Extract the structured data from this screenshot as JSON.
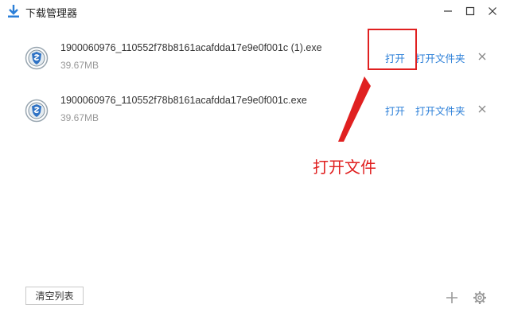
{
  "window": {
    "title": "下载管理器"
  },
  "downloads": [
    {
      "file_name": "1900060976_110552f78b8161acafdda17e9e0f001c (1).exe",
      "size": "39.67MB",
      "open_label": "打开",
      "open_folder_label": "打开文件夹"
    },
    {
      "file_name": "1900060976_110552f78b8161acafdda17e9e0f001c.exe",
      "size": "39.67MB",
      "open_label": "打开",
      "open_folder_label": "打开文件夹"
    }
  ],
  "annotation": {
    "label": "打开文件",
    "color": "#e02020"
  },
  "footer": {
    "clear_label": "清空列表"
  },
  "colors": {
    "link": "#2b7fd8",
    "title_icon": "#2b7fd8"
  }
}
